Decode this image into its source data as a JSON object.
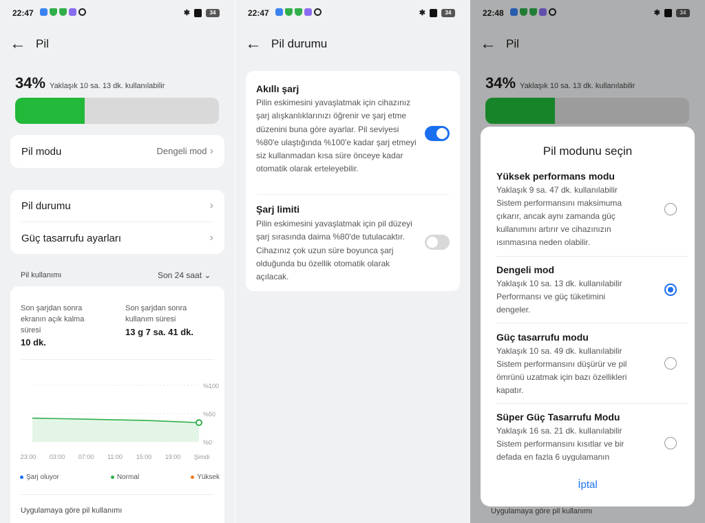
{
  "panel1": {
    "status": {
      "time": "22:47",
      "battery": "34"
    },
    "title": "Pil",
    "battery": {
      "percent": "34%",
      "remaining": "Yaklaşık 10 sa. 13 dk. kullanılabilir",
      "level": 0.34,
      "bar_color": "#22b83a"
    },
    "mode_row": {
      "label": "Pil modu",
      "value": "Dengeli mod"
    },
    "menu": [
      {
        "label": "Pil durumu"
      },
      {
        "label": "Güç tasarrufu ayarları"
      }
    ],
    "usage_header": {
      "label": "Pil kullanımı",
      "period": "Son 24 saat"
    },
    "stats": {
      "screen_label": "Son şarjdan sonra ekranın açık kalma süresi",
      "screen_value": "10 dk.",
      "usage_label": "Son şarjdan sonra kullanım süresi",
      "usage_value": "13 g 7 sa. 41 dk."
    },
    "chart_data": {
      "type": "area",
      "x": [
        "23:00",
        "03:00",
        "07:00",
        "11:00",
        "15:00",
        "19:00",
        "Şimdi"
      ],
      "y_ticks": [
        "%100",
        "%50",
        "%0"
      ],
      "ylim": [
        0,
        100
      ],
      "series": [
        {
          "values": [
            42,
            41,
            40,
            39,
            38,
            36,
            34
          ]
        }
      ],
      "legend": [
        {
          "name": "Şarj oluyor",
          "color": "#1a6ff0"
        },
        {
          "name": "Normal",
          "color": "#2fae4a"
        },
        {
          "name": "Yüksek",
          "color": "#f07a1a"
        }
      ]
    },
    "app_usage_label": "Uygulamaya göre pil kullanımı"
  },
  "panel2": {
    "status": {
      "time": "22:47",
      "battery": "34"
    },
    "title": "Pil durumu",
    "smart": {
      "title": "Akıllı şarj",
      "desc": "Pilin eskimesini yavaşlatmak için cihazınız şarj alışkanlıklarınızı öğrenir ve şarj etme düzenini buna göre ayarlar. Pil seviyesi %80'e ulaştığında %100'e kadar şarj etmeyi siz kullanmadan kısa süre önceye kadar otomatik olarak erteleyebilir.",
      "enabled": true
    },
    "limit": {
      "title": "Şarj limiti",
      "desc": "Pilin eskimesini yavaşlatmak için pil düzeyi şarj sırasında daima %80'de tutulacaktır. Cihazınız çok uzun süre boyunca şarj olduğunda bu özellik otomatik olarak açılacak.",
      "enabled": false
    }
  },
  "panel3": {
    "status": {
      "time": "22:48",
      "battery": "34"
    },
    "title": "Pil",
    "battery": {
      "percent": "34%",
      "remaining": "Yaklaşık 10 sa. 13 dk. kullanılabilir",
      "level": 0.34
    },
    "sheet": {
      "title": "Pil modunu seçin",
      "options": [
        {
          "title": "Yüksek performans modu",
          "time": "Yaklaşık 9 sa. 47 dk. kullanılabilir",
          "desc": "Sistem performansını maksimuma çıkarır, ancak aynı zamanda güç kullanımını artırır ve cihazınızın ısınmasına neden olabilir.",
          "selected": false
        },
        {
          "title": "Dengeli mod",
          "time": "Yaklaşık 10 sa. 13 dk. kullanılabilir",
          "desc": "Performansı ve güç tüketimini dengeler.",
          "selected": true
        },
        {
          "title": "Güç tasarrufu modu",
          "time": "Yaklaşık 10 sa. 49 dk. kullanılabilir",
          "desc": "Sistem performansını düşürür ve pil ömrünü uzatmak için bazı özellikleri kapatır.",
          "selected": false
        },
        {
          "title": "Süper Güç Tasarrufu Modu",
          "time": "Yaklaşık 16 sa. 21 dk. kullanılabilir",
          "desc": "Sistem performansını kısıtlar ve bir defada en fazla 6 uygulamanın",
          "selected": false
        }
      ],
      "cancel": "İptal"
    },
    "app_usage_label": "Uygulamaya göre pil kullanımı"
  }
}
